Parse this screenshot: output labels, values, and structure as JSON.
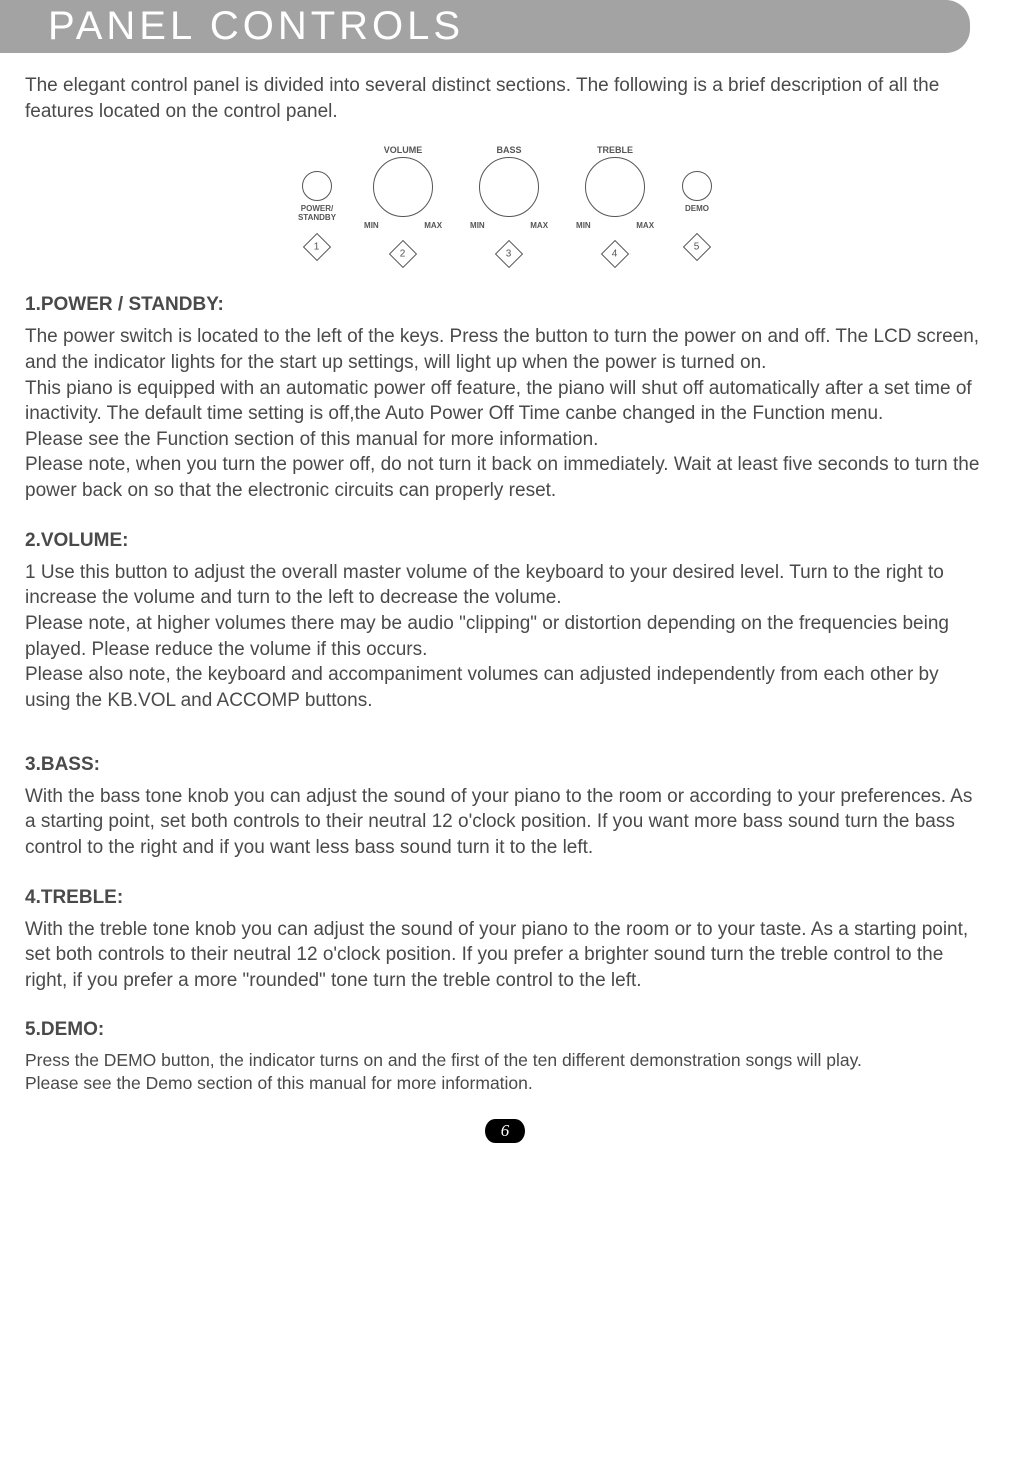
{
  "title": "PANEL CONTROLS",
  "intro": "The elegant control panel is divided into several distinct sections. The following is a brief description of all the features located on the control panel.",
  "diagram": {
    "controls": [
      {
        "num": "1",
        "type": "small",
        "topLabel": "",
        "bottomLabel": "POWER/\nSTANDBY"
      },
      {
        "num": "2",
        "type": "large",
        "topLabel": "VOLUME",
        "min": "MIN",
        "max": "MAX"
      },
      {
        "num": "3",
        "type": "large",
        "topLabel": "BASS",
        "min": "MIN",
        "max": "MAX"
      },
      {
        "num": "4",
        "type": "large",
        "topLabel": "TREBLE",
        "min": "MIN",
        "max": "MAX"
      },
      {
        "num": "5",
        "type": "small",
        "topLabel": "",
        "bottomLabel": "DEMO"
      }
    ]
  },
  "sections": [
    {
      "heading": "1.POWER / STANDBY:",
      "body": "The power switch is located to the left of the keys. Press the button to turn the power on and off. The LCD screen, and the indicator lights for the start up settings, will light up when the power is turned on.\nThis piano is equipped with an automatic power off feature, the piano will shut off automatically after a set time of inactivity. The default time setting is off,the Auto Power Off Time canbe changed in the Function menu.\nPlease see the Function section of this manual for more information.\nPlease note, when you turn the power off, do not turn it back on immediately. Wait at least five seconds to turn the power back on so that the electronic circuits can properly reset."
    },
    {
      "heading": "2.VOLUME:",
      "body": "1 Use this button to adjust the overall master volume of the keyboard to your desired level. Turn to the right to increase the volume and turn to the left to decrease the volume.\nPlease note, at higher volumes there may be audio \"clipping\" or distortion depending on the frequencies being played. Please reduce the volume if this occurs.\nPlease also note, the keyboard and accompaniment volumes can adjusted independently from each other by using the KB.VOL and ACCOMP buttons."
    },
    {
      "heading": "3.BASS:",
      "body": "With the bass tone knob you can adjust the sound of your piano to the room or according to your preferences. As a starting point, set both controls to their neutral 12 o'clock position. If you want more bass sound turn the bass control to the right and if you want less bass sound turn it to the left."
    },
    {
      "heading": "4.TREBLE:",
      "body": "With the treble tone knob you can adjust the sound of your piano to the room or to your taste. As a starting point, set both controls to their neutral 12 o'clock position. If you prefer a brighter sound turn the treble control to the right, if you prefer a more \"rounded\" tone turn the treble control to the left."
    },
    {
      "heading": "5.DEMO:",
      "body": "Press the DEMO button, the indicator turns on and the first of the ten different demonstration songs will play.\nPlease see the Demo section of this manual for more information.",
      "smaller": true
    }
  ],
  "pageNumber": "6"
}
